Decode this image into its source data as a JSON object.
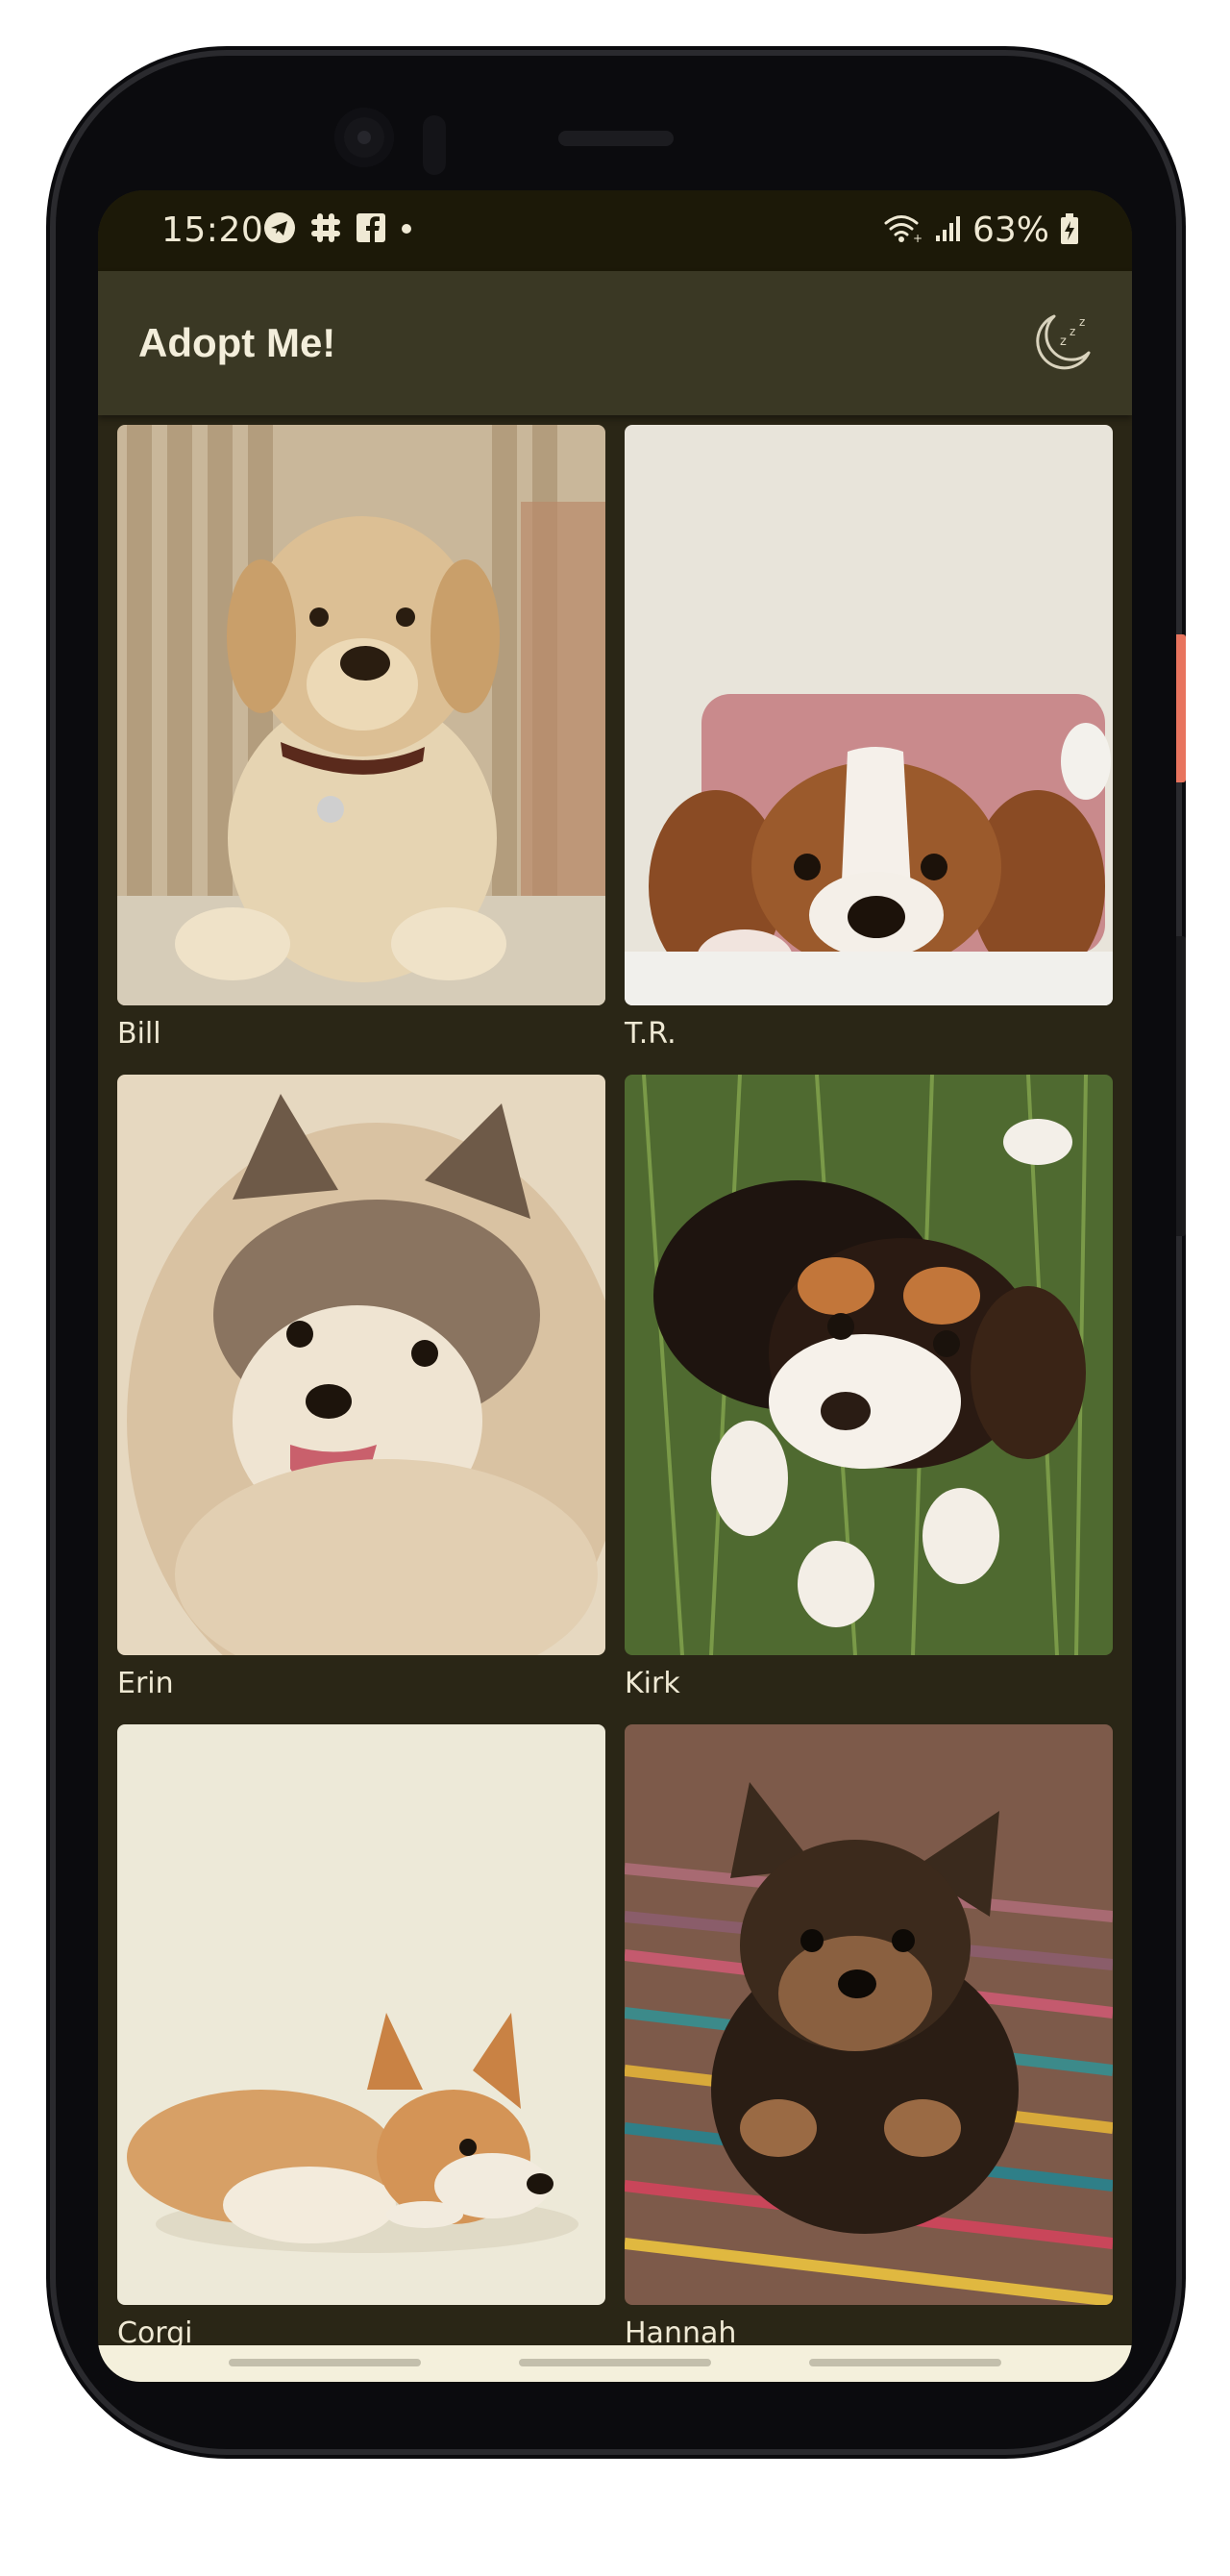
{
  "status_bar": {
    "time": "15:20",
    "battery_percent": "63%",
    "left_icons": [
      "telegram-icon",
      "slack-icon",
      "facebook-icon",
      "notification-dot-icon"
    ],
    "right_icons": [
      "wifi-icon",
      "signal-icon",
      "battery-charging-icon"
    ]
  },
  "app_bar": {
    "title": "Adopt Me!",
    "theme_toggle_icon": "moon-sleep-icon"
  },
  "pets": [
    {
      "name": "Bill",
      "photo": "golden-retriever-puppy-photo"
    },
    {
      "name": "T.R.",
      "photo": "cavalier-puppy-photo"
    },
    {
      "name": "Erin",
      "photo": "pomeranian-photo"
    },
    {
      "name": "Kirk",
      "photo": "tricolor-puppy-photo"
    },
    {
      "name": "Corgi",
      "photo": "corgi-photo"
    },
    {
      "name": "Hannah",
      "photo": "yorkie-puppy-photo"
    }
  ],
  "colors": {
    "background": "#2a2616",
    "app_bar": "#3a3824",
    "status_bar": "#1c1908",
    "text": "#efe9d4",
    "nav_strip": "#f4f0dc"
  }
}
